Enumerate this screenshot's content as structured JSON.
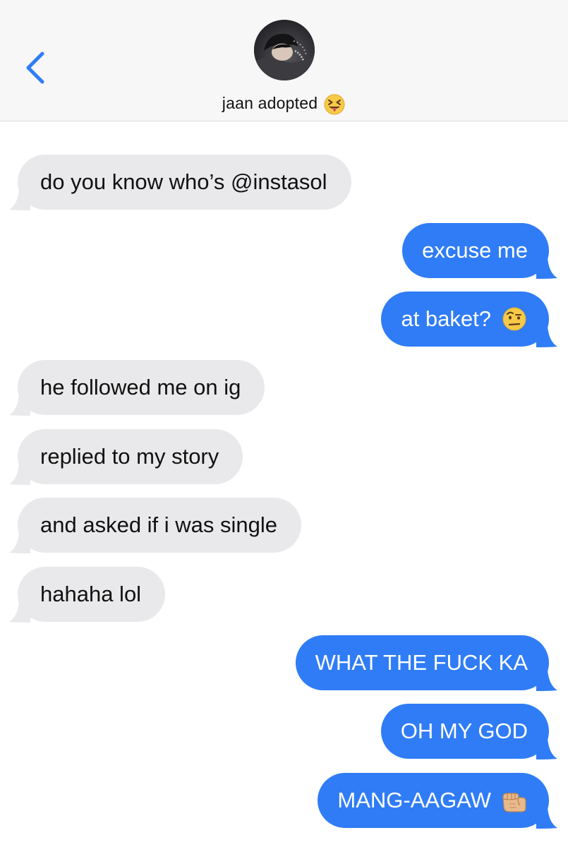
{
  "header": {
    "contact_name": "jaan adopted",
    "contact_emoji": "squinting-face-with-tongue",
    "back_icon": "chevron-left-icon"
  },
  "colors": {
    "accent": "#2f7cf6",
    "incoming_bubble": "#e9e9eb",
    "header_bg": "#f7f7f7"
  },
  "messages": [
    {
      "direction": "in",
      "text": "do you know who’s @instasol"
    },
    {
      "direction": "out",
      "text": "excuse me"
    },
    {
      "direction": "out",
      "text": "at baket?",
      "emoji": "face-with-raised-eyebrow"
    },
    {
      "direction": "in",
      "text": "he followed me on ig"
    },
    {
      "direction": "in",
      "text": "replied to my story"
    },
    {
      "direction": "in",
      "text": "and asked if i was single"
    },
    {
      "direction": "in",
      "text": "hahaha lol"
    },
    {
      "direction": "out",
      "text": "WHAT THE FUCK KA"
    },
    {
      "direction": "out",
      "text": "OH MY GOD"
    },
    {
      "direction": "out",
      "text": "MANG-AAGAW",
      "emoji": "oncoming-fist"
    }
  ]
}
